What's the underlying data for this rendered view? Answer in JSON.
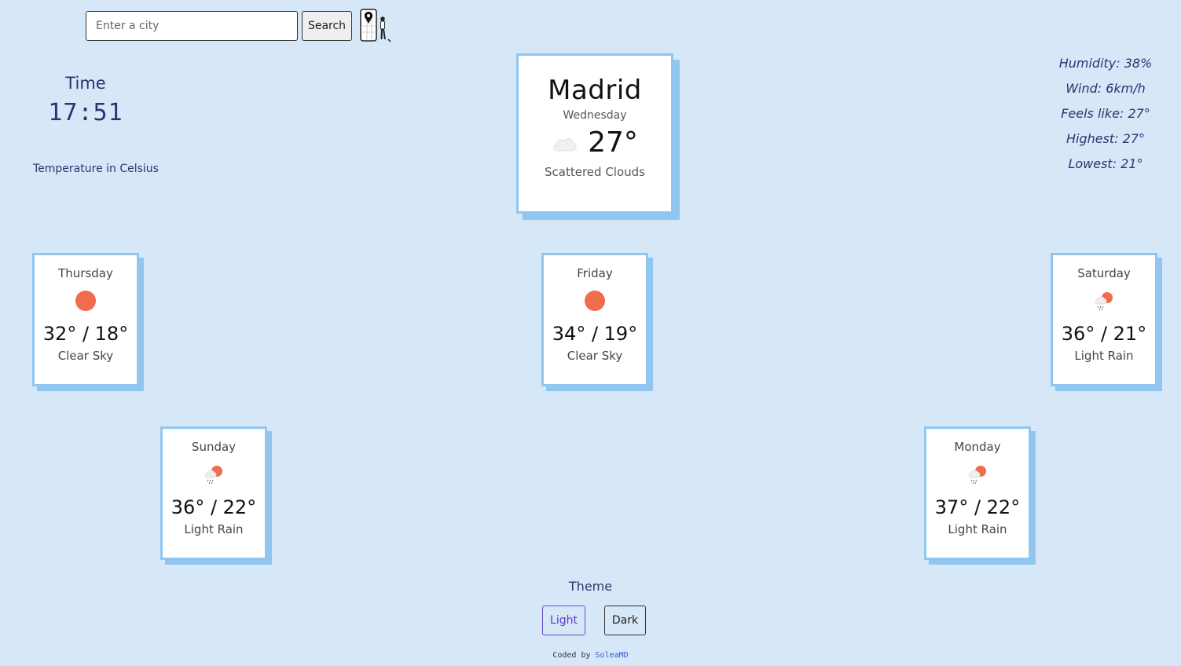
{
  "search": {
    "placeholder": "Enter a city",
    "button_label": "Search"
  },
  "time": {
    "title": "Time",
    "value": "17:51"
  },
  "units_note": "Temperature in Celsius",
  "current": {
    "city": "Madrid",
    "day": "Wednesday",
    "temperature": "27°",
    "description": "Scattered Clouds",
    "icon": "cloud-icon"
  },
  "details": {
    "humidity": "Humidity: 38%",
    "wind": "Wind: 6km/h",
    "feels_like": "Feels like: 27°",
    "highest": "Highest: 27°",
    "lowest": "Lowest: 21°"
  },
  "forecast": [
    {
      "day": "Thursday",
      "temps": "32° / 18°",
      "description": "Clear Sky",
      "icon": "sun-icon"
    },
    {
      "day": "Friday",
      "temps": "34° / 19°",
      "description": "Clear Sky",
      "icon": "sun-icon"
    },
    {
      "day": "Saturday",
      "temps": "36° / 21°",
      "description": "Light Rain",
      "icon": "rain-sun-icon"
    },
    {
      "day": "Sunday",
      "temps": "36° / 22°",
      "description": "Light Rain",
      "icon": "rain-sun-icon"
    },
    {
      "day": "Monday",
      "temps": "37° / 22°",
      "description": "Light Rain",
      "icon": "rain-sun-icon"
    }
  ],
  "theme": {
    "label": "Theme",
    "light_label": "Light",
    "dark_label": "Dark"
  },
  "footer": {
    "prefix": "Coded by ",
    "author": "SoleaMD"
  },
  "colors": {
    "background": "#d6e7f7",
    "card_border": "#90c6f0",
    "sun": "#ef6c4c",
    "accent": "#2a3570"
  }
}
